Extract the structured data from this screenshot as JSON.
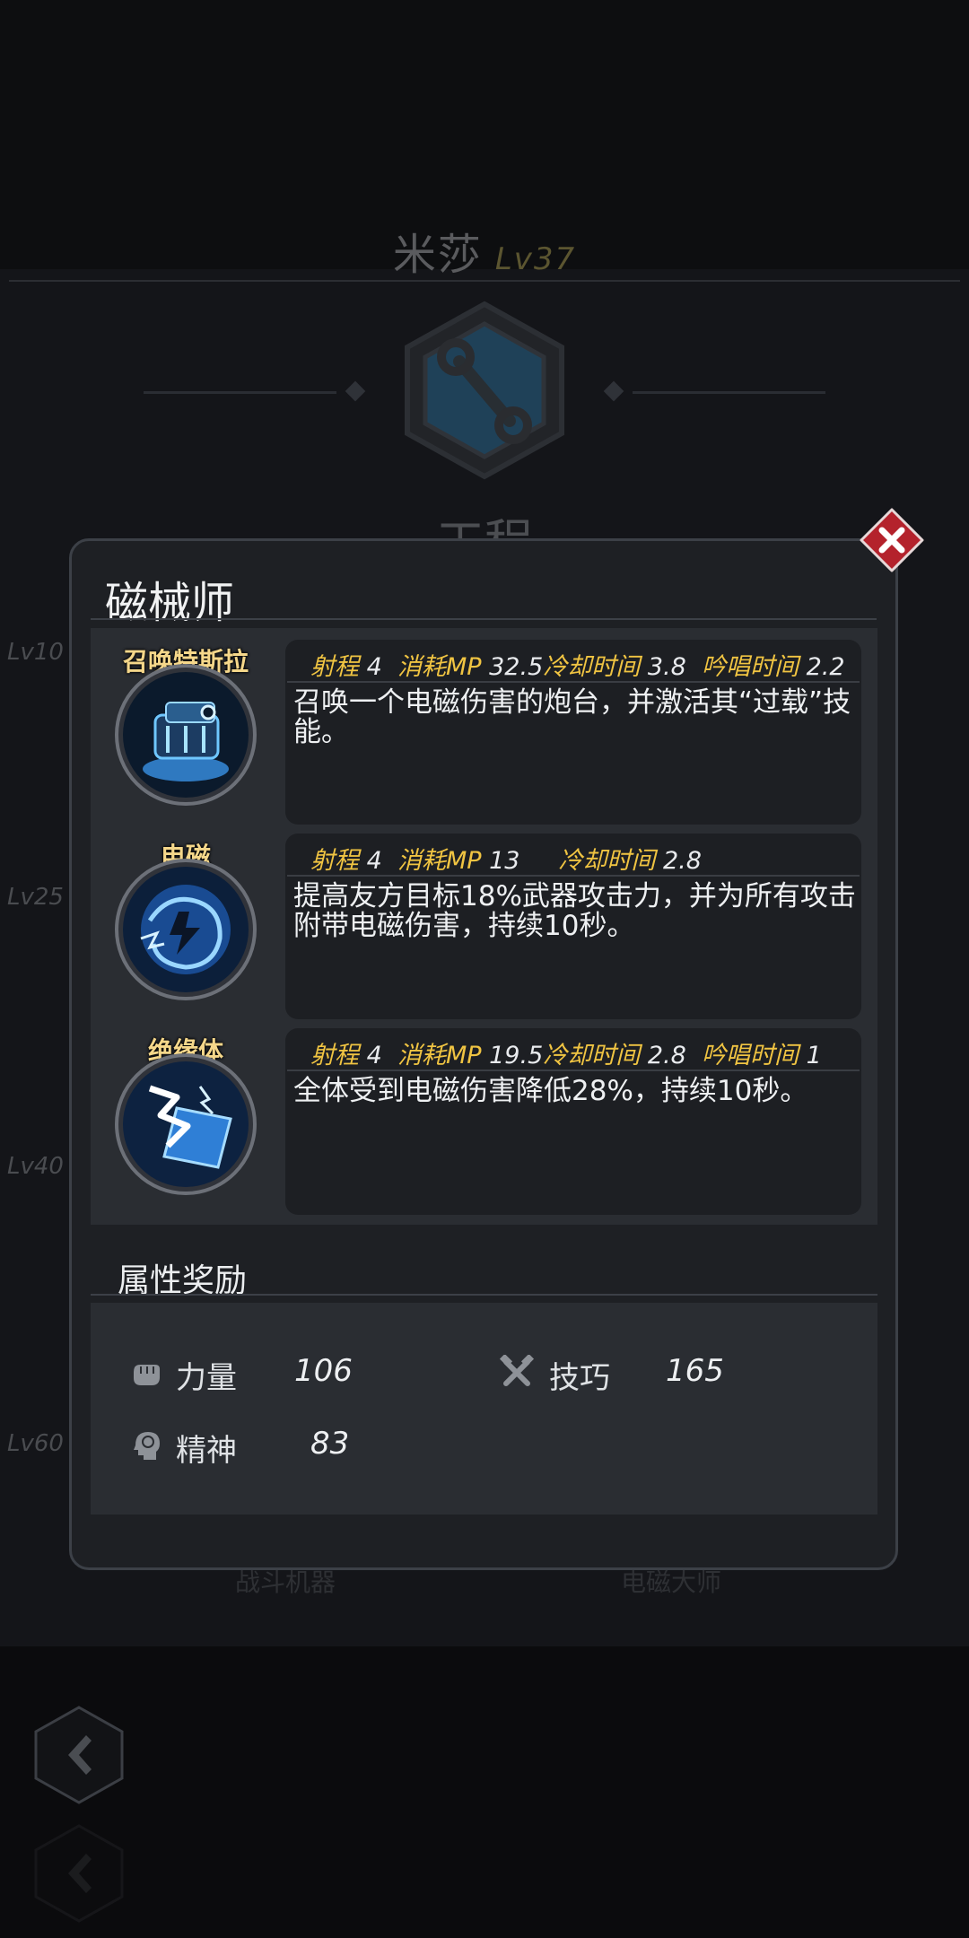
{
  "background": {
    "character_name": "米莎",
    "character_level": "Lv37",
    "class_name": "工程",
    "level_markers": [
      "Lv10",
      "Lv25",
      "Lv40",
      "Lv60"
    ],
    "lower_labels": [
      "战斗机器",
      "电磁大师"
    ]
  },
  "dialog": {
    "title": "磁械师",
    "skills": [
      {
        "name": "召唤特斯拉",
        "icon": "tesla-turret-icon",
        "stat_labels": {
          "range": "射程",
          "mp": "消耗MP",
          "cooldown": "冷却时间",
          "cast": "吟唱时间"
        },
        "range": "4",
        "mp": "32.5",
        "cooldown": "3.8",
        "cast": "2.2",
        "description": "召唤一个电磁伤害的炮台，并激活其“过载”技能。"
      },
      {
        "name": "电磁",
        "icon": "electromagnetic-aura-icon",
        "stat_labels": {
          "range": "射程",
          "mp": "消耗MP",
          "cooldown": "冷却时间"
        },
        "range": "4",
        "mp": "13",
        "cooldown": "2.8",
        "description": "提高友方目标18%武器攻击力，并为所有攻击附带电磁伤害，持续10秒。"
      },
      {
        "name": "绝缘体",
        "icon": "insulator-shield-icon",
        "stat_labels": {
          "range": "射程",
          "mp": "消耗MP",
          "cooldown": "冷却时间",
          "cast": "吟唱时间"
        },
        "range": "4",
        "mp": "19.5",
        "cooldown": "2.8",
        "cast": "1",
        "description": "全体受到电磁伤害降低28%，持续10秒。"
      }
    ],
    "bonus": {
      "title": "属性奖励",
      "attributes": [
        {
          "icon": "fist-icon",
          "label": "力量",
          "value": "106"
        },
        {
          "icon": "crossed-tools-icon",
          "label": "技巧",
          "value": "165"
        },
        {
          "icon": "head-brain-icon",
          "label": "精神",
          "value": "83"
        }
      ]
    }
  },
  "colors": {
    "accent_gold": "#f0c442",
    "close_red": "#b4222c",
    "class_badge": "#1e5a80"
  }
}
